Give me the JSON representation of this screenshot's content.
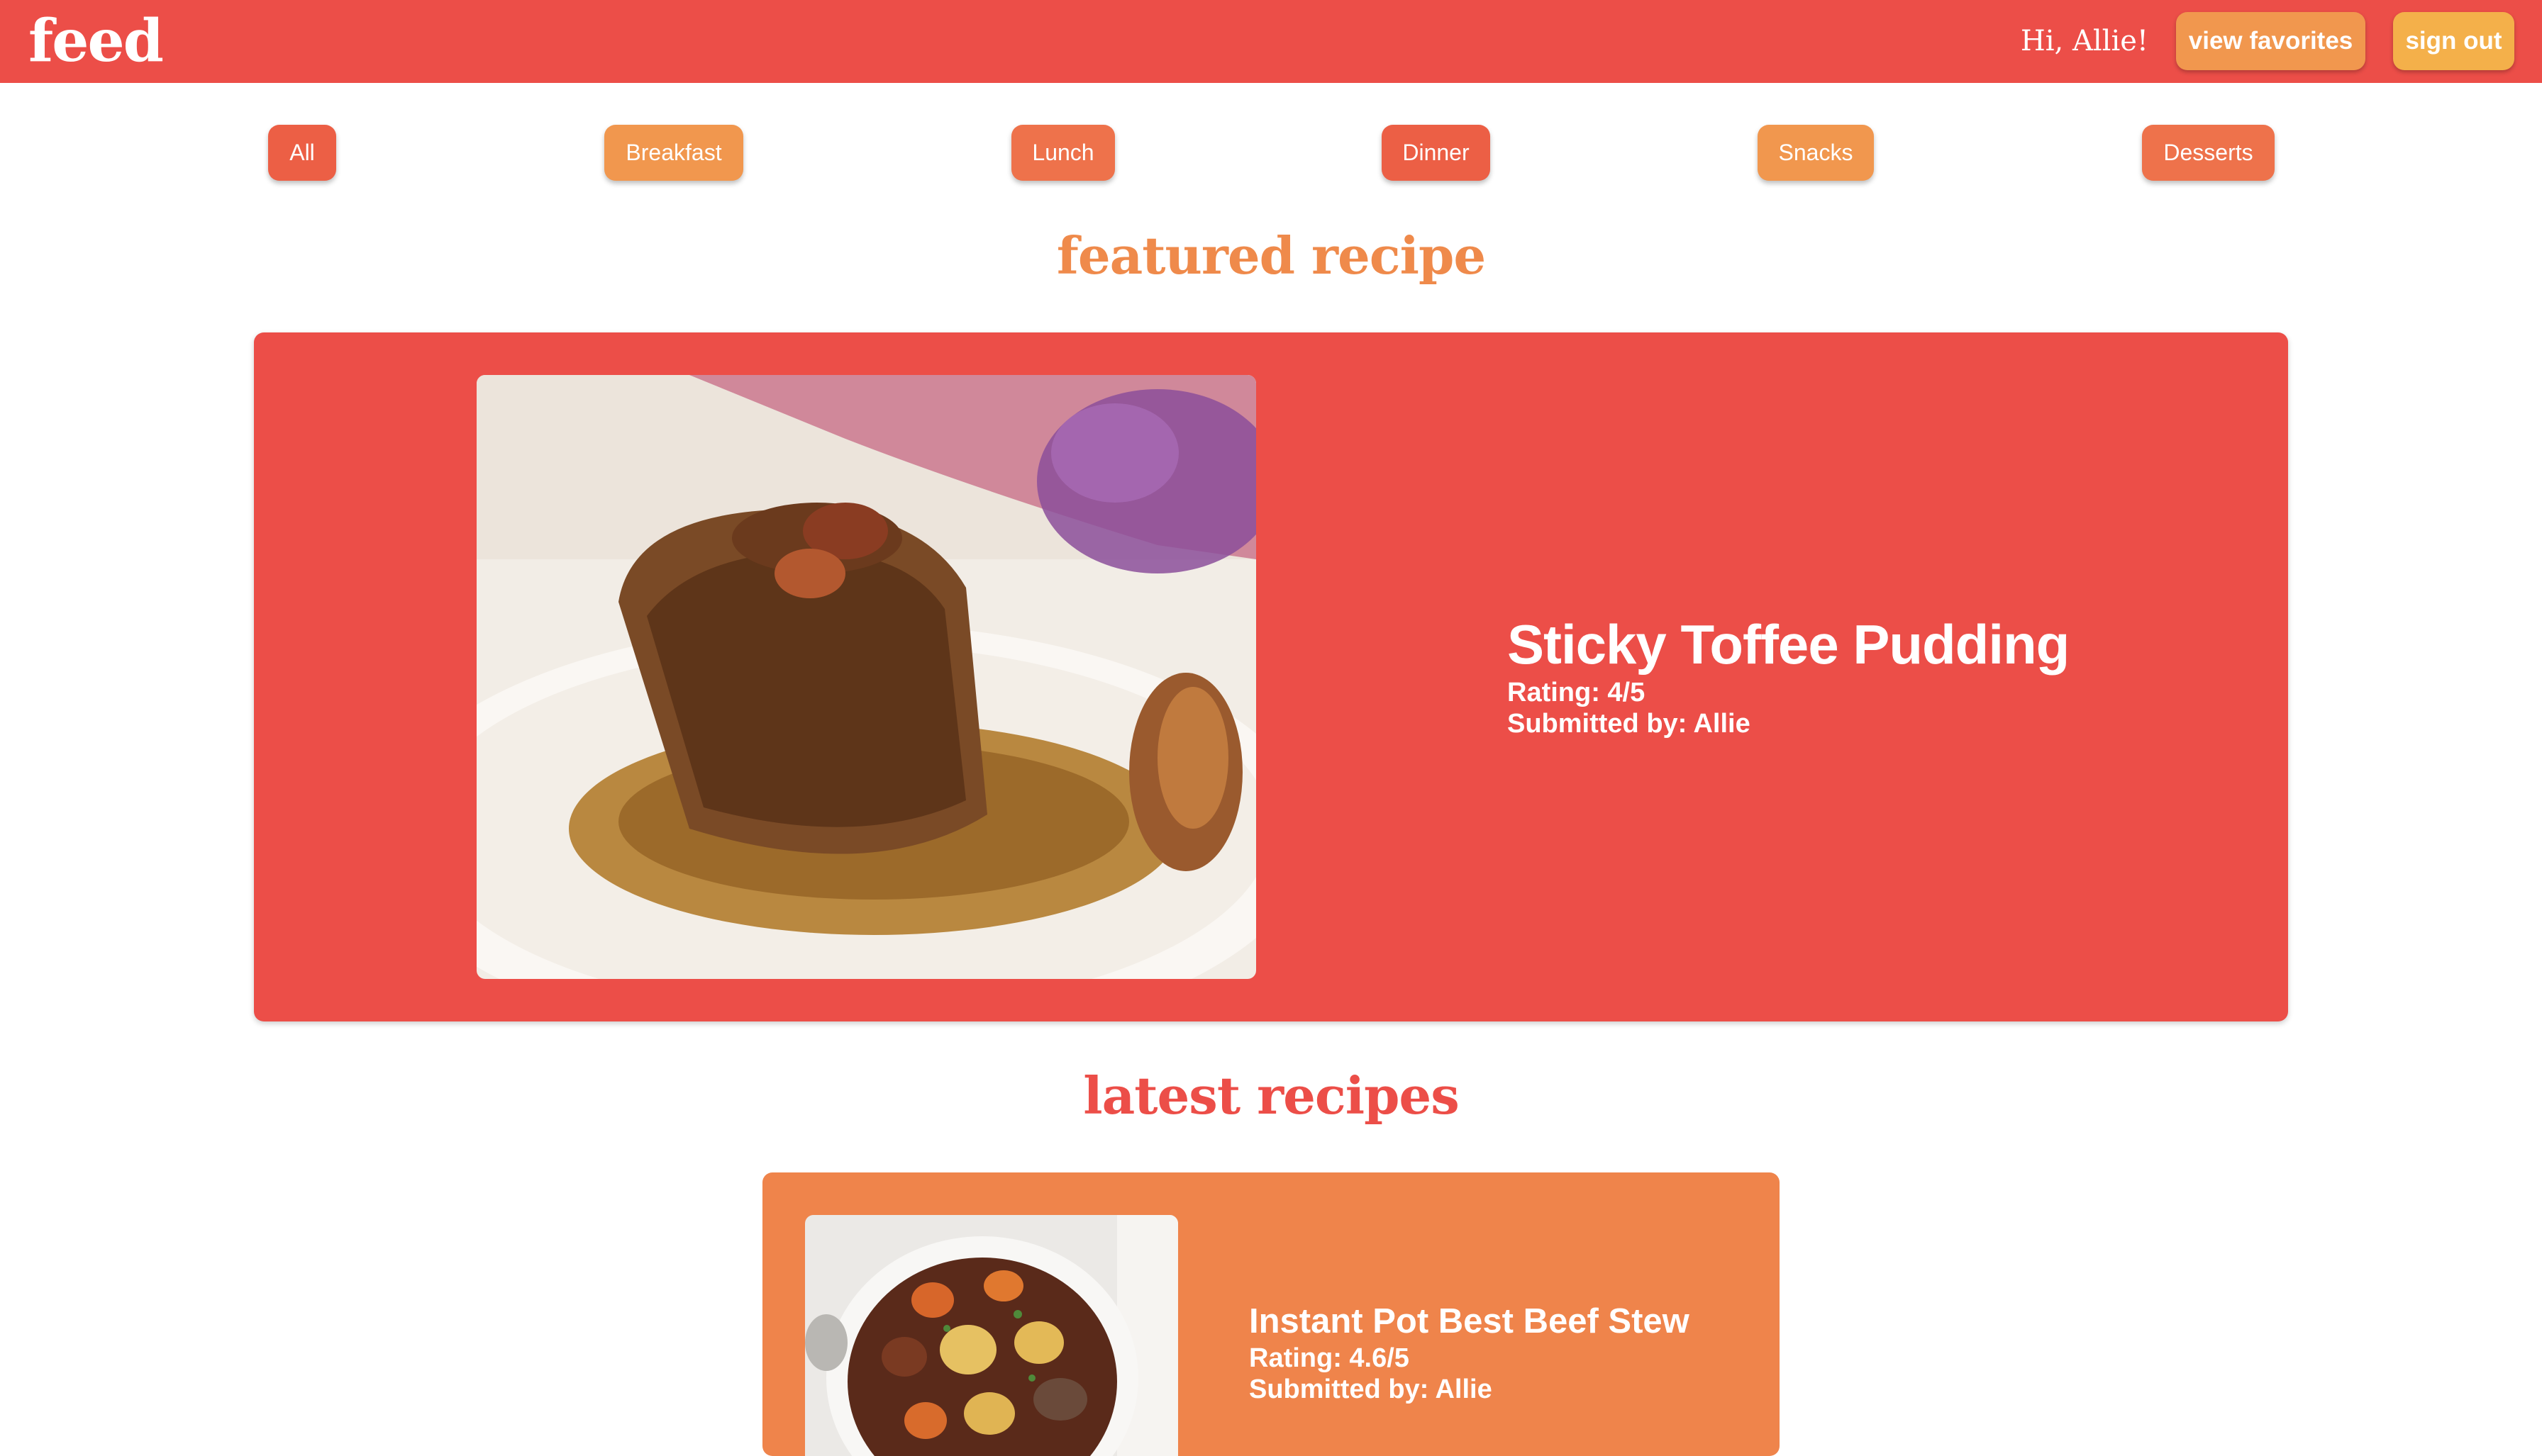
{
  "header": {
    "logo": "feed",
    "greeting": "Hi, Allie!",
    "favorites_label": "view favorites",
    "signout_label": "sign out"
  },
  "categories": [
    "All",
    "Breakfast",
    "Lunch",
    "Dinner",
    "Snacks",
    "Desserts"
  ],
  "featured": {
    "section_title": "featured recipe",
    "name": "Sticky Toffee Pudding",
    "rating": "Rating: 4/5",
    "submitted_by": "Submitted by: Allie"
  },
  "latest": {
    "section_title": "latest recipes",
    "items": [
      {
        "name": "Instant Pot Best Beef Stew",
        "rating": "Rating: 4.6/5",
        "submitted_by": "Submitted by: Allie"
      }
    ]
  },
  "colors": {
    "brand_red": "#ec4e48",
    "brand_orange": "#ef844b",
    "accent_amber": "#f4b04a",
    "accent_light_orange": "#f1974e"
  }
}
